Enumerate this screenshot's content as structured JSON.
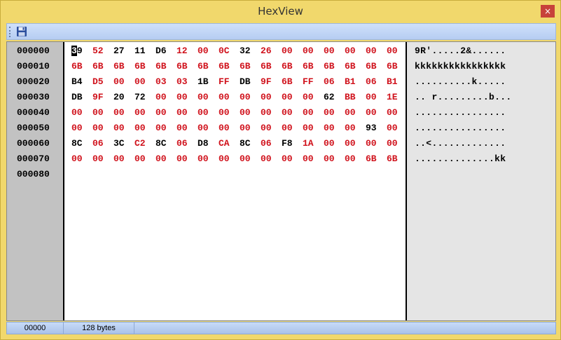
{
  "window": {
    "title": "HexView",
    "close_label": "×"
  },
  "toolbar": {
    "save_icon": "save-icon"
  },
  "offsets": [
    "000000",
    "000010",
    "000020",
    "000030",
    "000040",
    "000050",
    "000060",
    "000070",
    "000080"
  ],
  "hex_rows": [
    [
      "39",
      "52",
      "27",
      "11",
      "D6",
      "12",
      "00",
      "0C",
      "32",
      "26",
      "00",
      "00",
      "00",
      "00",
      "00",
      "00"
    ],
    [
      "6B",
      "6B",
      "6B",
      "6B",
      "6B",
      "6B",
      "6B",
      "6B",
      "6B",
      "6B",
      "6B",
      "6B",
      "6B",
      "6B",
      "6B",
      "6B"
    ],
    [
      "B4",
      "D5",
      "00",
      "00",
      "03",
      "03",
      "1B",
      "FF",
      "DB",
      "9F",
      "6B",
      "FF",
      "06",
      "B1",
      "06",
      "B1"
    ],
    [
      "DB",
      "9F",
      "20",
      "72",
      "00",
      "00",
      "00",
      "00",
      "00",
      "00",
      "00",
      "00",
      "62",
      "BB",
      "00",
      "1E"
    ],
    [
      "00",
      "00",
      "00",
      "00",
      "00",
      "00",
      "00",
      "00",
      "00",
      "00",
      "00",
      "00",
      "00",
      "00",
      "00",
      "00"
    ],
    [
      "00",
      "00",
      "00",
      "00",
      "00",
      "00",
      "00",
      "00",
      "00",
      "00",
      "00",
      "00",
      "00",
      "00",
      "93",
      "00"
    ],
    [
      "8C",
      "06",
      "3C",
      "C2",
      "8C",
      "06",
      "D8",
      "CA",
      "8C",
      "06",
      "F8",
      "1A",
      "00",
      "00",
      "00",
      "00"
    ],
    [
      "00",
      "00",
      "00",
      "00",
      "00",
      "00",
      "00",
      "00",
      "00",
      "00",
      "00",
      "00",
      "00",
      "00",
      "6B",
      "6B"
    ]
  ],
  "ascii_rows": [
    "9R'.....2&......",
    "kkkkkkkkkkkkkkkk",
    "..........k.....",
    ".. r.........b...",
    "................",
    "................",
    "..<.............",
    "..............kk"
  ],
  "status": {
    "offset": "00000",
    "size": "128 bytes"
  }
}
